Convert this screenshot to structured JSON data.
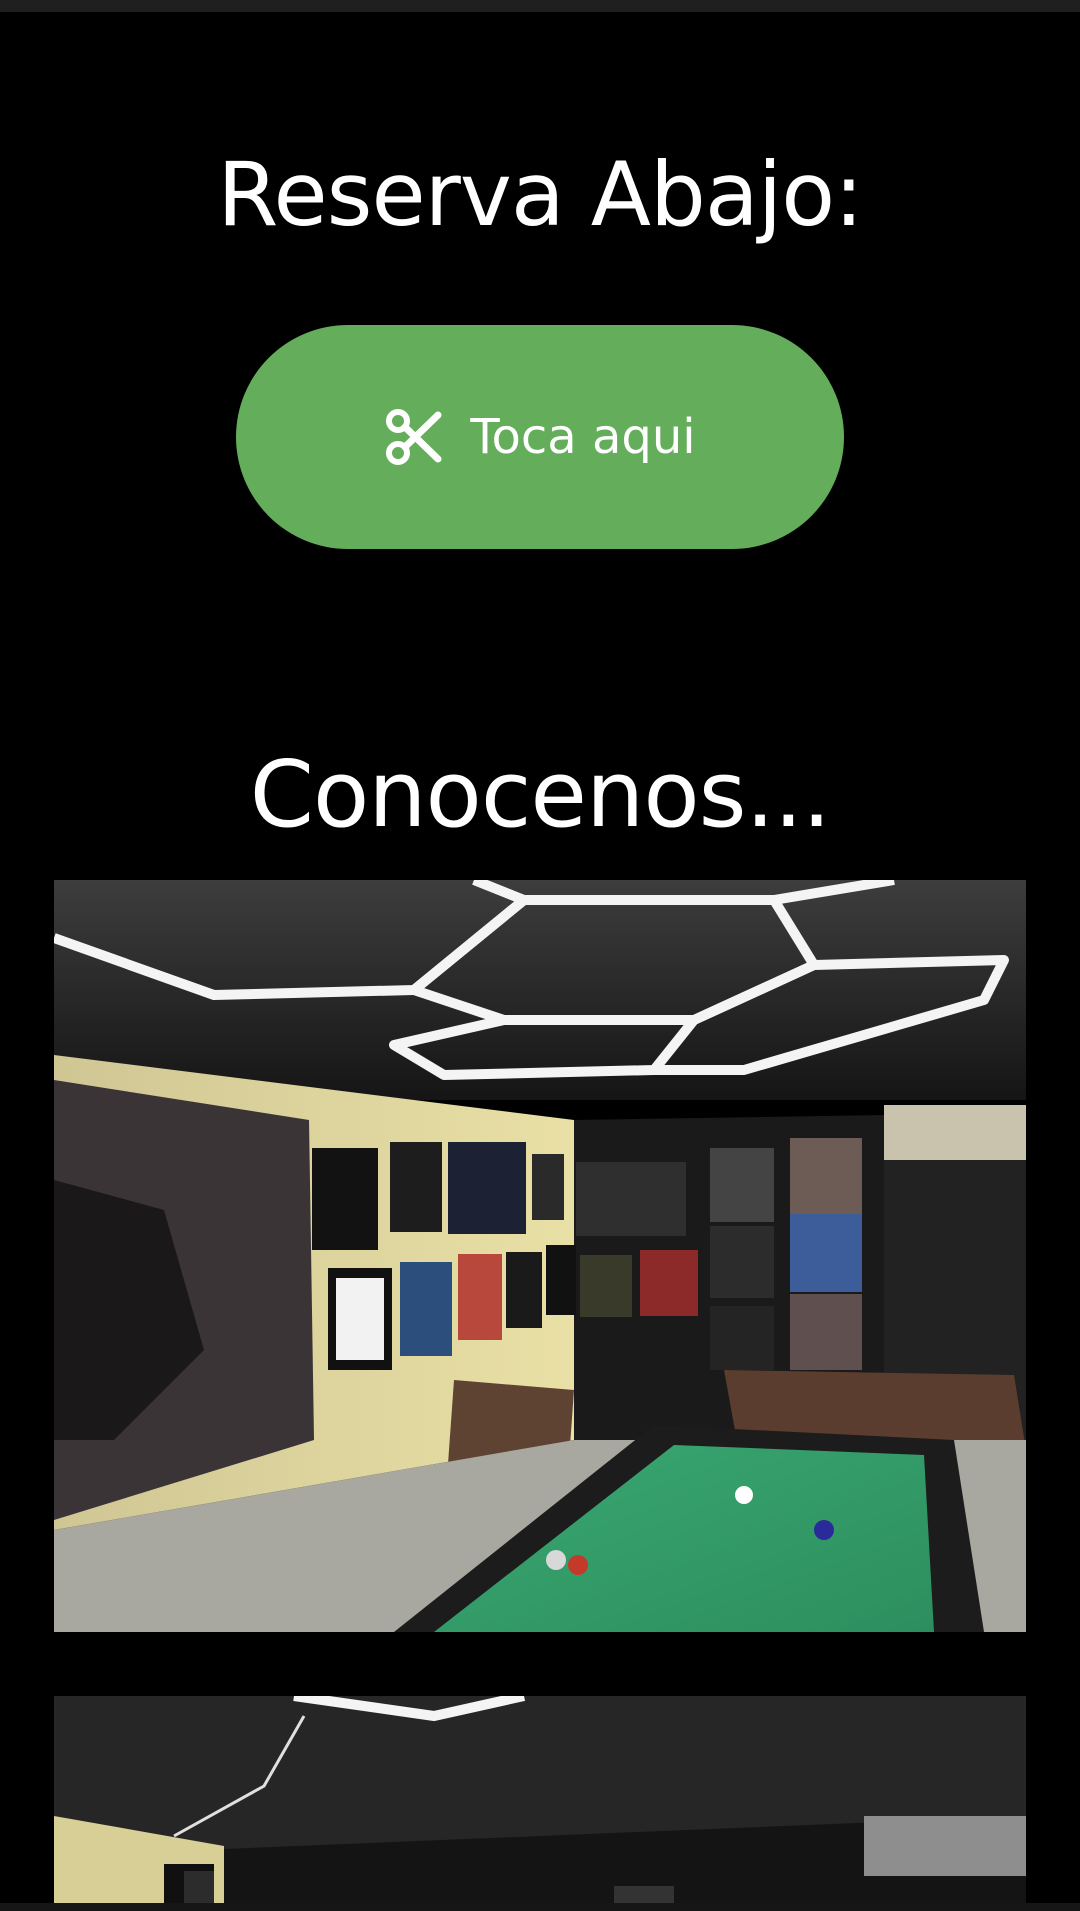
{
  "section_reserve": {
    "title": "Reserva Abajo:",
    "button_label": "Toca aqui",
    "button_icon": "scissors-icon",
    "button_color": "#64ad5a"
  },
  "section_about": {
    "title": "Conocenos...",
    "photos": [
      {
        "subject": "pool-room"
      },
      {
        "subject": "pool-room"
      }
    ]
  },
  "colors": {
    "background": "#000000",
    "text": "#ffffff",
    "accent": "#64ad5a"
  }
}
